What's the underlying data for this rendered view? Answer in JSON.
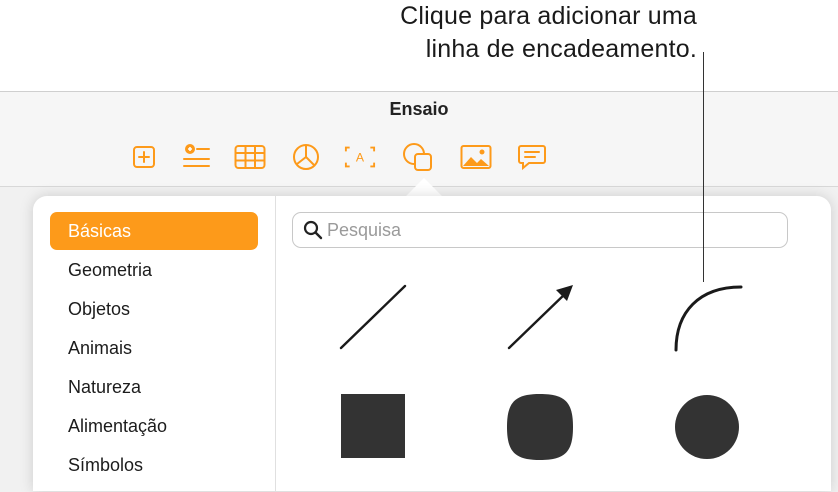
{
  "callout": {
    "line1": "Clique para adicionar uma",
    "line2": "linha de encadeamento."
  },
  "window": {
    "title": "Ensaio"
  },
  "toolbar": {
    "accent_color": "#fd9a1a",
    "icons": [
      "add-page-icon",
      "insert-list-icon",
      "table-icon",
      "chart-icon",
      "text-box-icon",
      "shape-icon",
      "media-icon",
      "comment-icon"
    ]
  },
  "sidebar": {
    "selected_color": "#fd9a1a",
    "items": [
      {
        "label": "Básicas",
        "selected": true
      },
      {
        "label": "Geometria",
        "selected": false
      },
      {
        "label": "Objetos",
        "selected": false
      },
      {
        "label": "Animais",
        "selected": false
      },
      {
        "label": "Natureza",
        "selected": false
      },
      {
        "label": "Alimentação",
        "selected": false
      },
      {
        "label": "Símbolos",
        "selected": false
      }
    ]
  },
  "search": {
    "placeholder": "Pesquisa",
    "value": ""
  },
  "shapes": {
    "fill_color": "#333333",
    "items": [
      "line",
      "arrow",
      "curve",
      "square",
      "rounded-square",
      "circle"
    ]
  }
}
